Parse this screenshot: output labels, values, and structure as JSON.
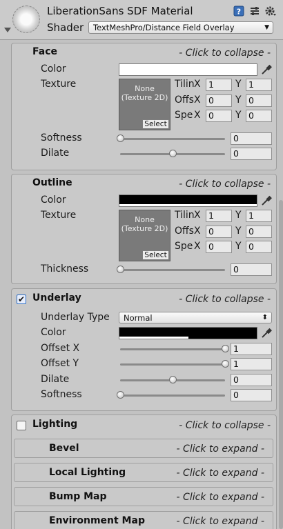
{
  "header": {
    "material_name": "LiberationSans SDF Material",
    "shader_label": "Shader",
    "shader_value": "TextMeshPro/Distance Field Overlay",
    "icons": [
      "material-preview-icon",
      "help-icon",
      "presets-icon",
      "gear-icon",
      "foldout-arrow-icon"
    ]
  },
  "face": {
    "title": "Face",
    "collapse": "- Click to collapse -",
    "color_label": "Color",
    "color": "#ffffff",
    "texture_label": "Texture",
    "texture_none": "None",
    "texture_type": "(Texture 2D)",
    "select_label": "Select",
    "tiling_label": "Tilin",
    "offset_label": "Offs",
    "speed_label": "Spe",
    "x_label": "X",
    "y_label": "Y",
    "tiling_x": "1",
    "tiling_y": "1",
    "offset_x": "0",
    "offset_y": "0",
    "speed_x": "0",
    "speed_y": "0",
    "softness_label": "Softness",
    "softness": "0",
    "softness_level": 0,
    "dilate_label": "Dilate",
    "dilate": "0",
    "dilate_level": 0.5
  },
  "outline": {
    "title": "Outline",
    "collapse": "- Click to collapse -",
    "color_label": "Color",
    "color": "#000000",
    "texture_label": "Texture",
    "texture_none": "None",
    "texture_type": "(Texture 2D)",
    "select_label": "Select",
    "tiling_label": "Tilin",
    "offset_label": "Offs",
    "speed_label": "Spe",
    "x_label": "X",
    "y_label": "Y",
    "tiling_x": "1",
    "tiling_y": "1",
    "offset_x": "0",
    "offset_y": "0",
    "speed_x": "0",
    "speed_y": "0",
    "thickness_label": "Thickness",
    "thickness": "0",
    "thickness_level": 0
  },
  "underlay": {
    "title": "Underlay",
    "checked": true,
    "check_mark": "✔",
    "collapse": "- Click to collapse -",
    "type_label": "Underlay Type",
    "type_value": "Normal",
    "color_label": "Color",
    "color": "#000000",
    "offset_x_label": "Offset X",
    "offset_x": "1",
    "offset_x_level": 1,
    "offset_y_label": "Offset Y",
    "offset_y": "1",
    "offset_y_level": 1,
    "dilate_label": "Dilate",
    "dilate": "0",
    "dilate_level": 0.5,
    "softness_label": "Softness",
    "softness": "0",
    "softness_level": 0
  },
  "lighting": {
    "title": "Lighting",
    "checked": false,
    "collapse": "- Click to collapse -",
    "sections": [
      {
        "title": "Bevel",
        "expand": "- Click to expand -"
      },
      {
        "title": "Local Lighting",
        "expand": "- Click to expand -"
      },
      {
        "title": "Bump Map",
        "expand": "- Click to expand -"
      },
      {
        "title": "Environment Map",
        "expand": "- Click to expand -"
      }
    ]
  },
  "colors": {
    "panel_bg": "#c9c9c9",
    "window_bg": "#c2c2c2",
    "checkbox_blue": "#2b6cc4"
  }
}
